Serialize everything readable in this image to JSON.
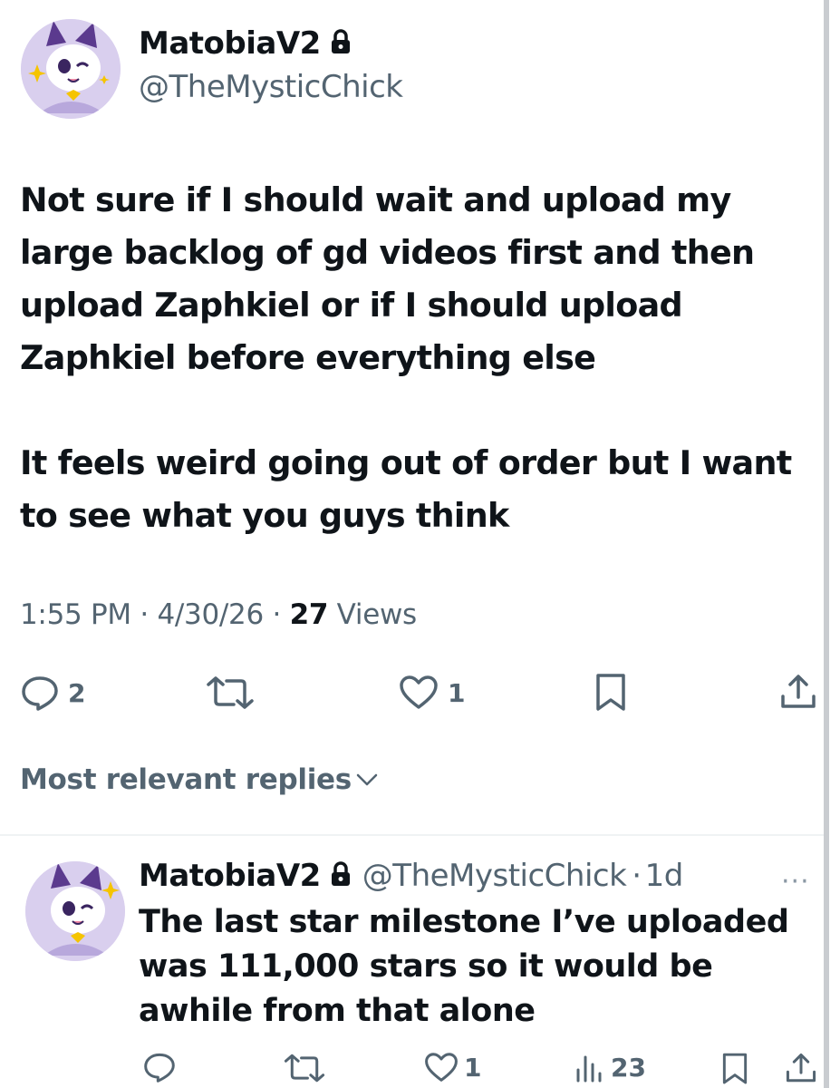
{
  "tweet": {
    "author": {
      "display_name": "MatobiaV2",
      "handle": "@TheMysticChick",
      "protected": true
    },
    "text_paragraphs": [
      "Not sure if I should wait and upload my large backlog of gd videos first and then upload Zaphkiel or if I should upload Zaphkiel before everything else",
      "It feels weird going out of order but I want to see what you guys think"
    ],
    "time": "1:55 PM",
    "date": "4/30/26",
    "views_count": "27",
    "views_label": "Views",
    "separator": " · ",
    "actions": {
      "reply_count": "2",
      "like_count": "1"
    }
  },
  "replies_header": {
    "label": "Most relevant replies"
  },
  "reply": {
    "author": {
      "display_name": "MatobiaV2",
      "handle": "@TheMysticChick",
      "age": "1d"
    },
    "age_separator": "·",
    "more_label": "···",
    "text": "The last star milestone I’ve uploaded was 111,000 stars so it would be awhile from that alone",
    "actions": {
      "like_count": "1",
      "views_count": "23"
    }
  },
  "colors": {
    "text_primary": "#0f1419",
    "text_secondary": "#536471",
    "avatar_bg": "#d9cfee",
    "avatar_purple": "#5b3a8e",
    "avatar_yellow": "#f5c400"
  },
  "icons": [
    "lock-icon",
    "reply-icon",
    "retweet-icon",
    "heart-icon",
    "bookmark-icon",
    "share-icon",
    "chevron-down-icon",
    "views-icon",
    "more-icon"
  ]
}
